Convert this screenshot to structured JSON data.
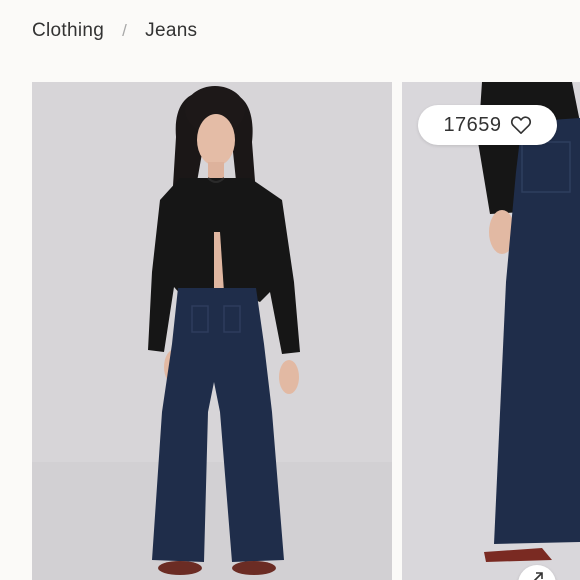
{
  "breadcrumb": {
    "items": [
      "Clothing",
      "Jeans"
    ],
    "separator": "/"
  },
  "gallery": {
    "likes": "17659",
    "like_icon": "heart-outline-icon",
    "expand_icon": "expand-arrow-icon",
    "colors": {
      "background": "#fbfaf8",
      "photo_backdrop": "#d8d6d9",
      "denim": "#1f2d4a",
      "cardigan": "#141414"
    }
  }
}
